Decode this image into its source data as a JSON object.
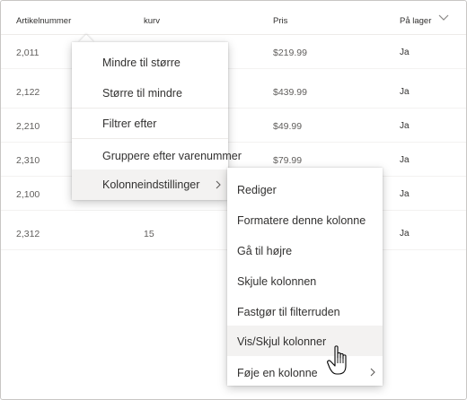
{
  "table": {
    "headers": {
      "article_number": "Artikelnummer",
      "basket": "kurv",
      "price": "Pris",
      "in_stock": "På lager"
    },
    "rows": [
      {
        "article_number": "2,011",
        "basket": "",
        "price": "$219.99",
        "in_stock": "Ja"
      },
      {
        "article_number": "2,122",
        "basket": "",
        "price": "$439.99",
        "in_stock": "Ja"
      },
      {
        "article_number": "2,210",
        "basket": "",
        "price": "$49.99",
        "in_stock": "Ja"
      },
      {
        "article_number": "2,310",
        "basket": "",
        "price": "$79.99",
        "in_stock": "Ja"
      },
      {
        "article_number": "2,100",
        "basket": "",
        "price": "",
        "in_stock": "Ja"
      },
      {
        "article_number": "2,312",
        "basket": "15",
        "price": "",
        "in_stock": "Ja"
      }
    ]
  },
  "column_menu": {
    "items": [
      {
        "label": "Mindre til større"
      },
      {
        "label": "Større til mindre"
      },
      {
        "label": "Filtrer efter"
      },
      {
        "label": "Gruppere efter varenummer"
      },
      {
        "label": "Kolonneindstillinger",
        "has_submenu": true,
        "highlighted": true
      }
    ]
  },
  "settings_submenu": {
    "items": [
      {
        "label": "Rediger"
      },
      {
        "label": "Formatere denne kolonne"
      },
      {
        "label": "Gå til højre"
      },
      {
        "label": "Skjule kolonnen"
      },
      {
        "label": "Fastgør til filterruden"
      },
      {
        "label": "Vis/Skjul kolonner",
        "highlighted": true
      },
      {
        "label": "Føje en kolonne",
        "has_submenu": true
      }
    ]
  },
  "icons": {
    "column_chevron": "chevron-down-icon",
    "submenu_arrow": "chevron-right-icon",
    "pointer": "hand-pointer-icon"
  },
  "colors": {
    "highlight": "#f3f2f1",
    "text": "#323130",
    "muted_text": "#605e5c",
    "divider": "#edebe9"
  }
}
